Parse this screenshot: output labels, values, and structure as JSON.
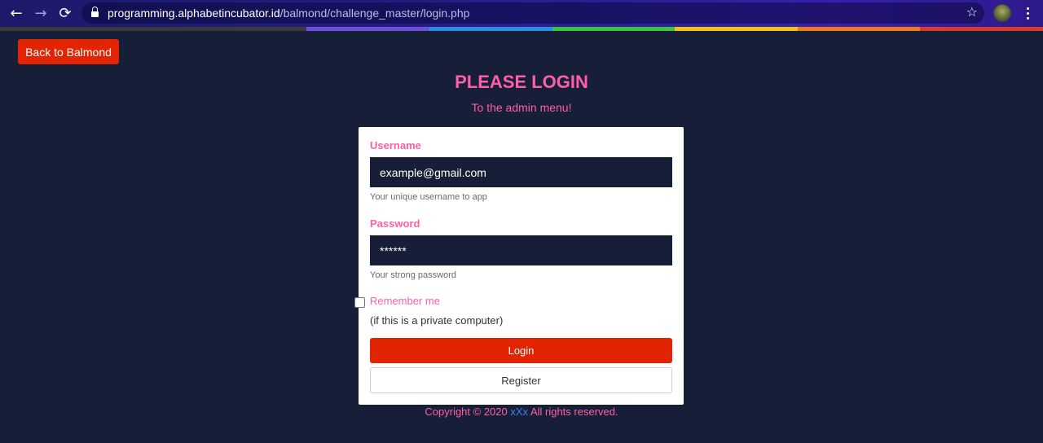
{
  "browser": {
    "url_host": "programming.alphabetincubator.id",
    "url_path": "/balmond/challenge_master/login.php",
    "back_icon": "←",
    "forward_icon": "→",
    "reload_icon": "⟳",
    "star_icon": "☆"
  },
  "page": {
    "back_button": "Back to Balmond",
    "title": "PLEASE LOGIN",
    "subtitle": "To the admin menu!"
  },
  "form": {
    "username_label": "Username",
    "username_value": "example@gmail.com",
    "username_help": "Your unique username to app",
    "password_label": "Password",
    "password_value": "******",
    "password_help": "Your strong password",
    "remember_label": "Remember me",
    "remember_note": "(if this is a private computer)",
    "login_button": "Login",
    "register_button": "Register"
  },
  "footer": {
    "prefix": "Copyright © 2020 ",
    "brand": "xXx",
    "suffix": " All rights reserved."
  },
  "colors": {
    "background": "#161f37",
    "accent_pink": "#ff5fa7",
    "button_red": "#e32403",
    "link_blue": "#3b82e8",
    "rainbow": [
      "#3a3a3a",
      "#6c4fd8",
      "#2d8de0",
      "#3cc23c",
      "#f5c214",
      "#f07a1a",
      "#d93b2b"
    ]
  }
}
